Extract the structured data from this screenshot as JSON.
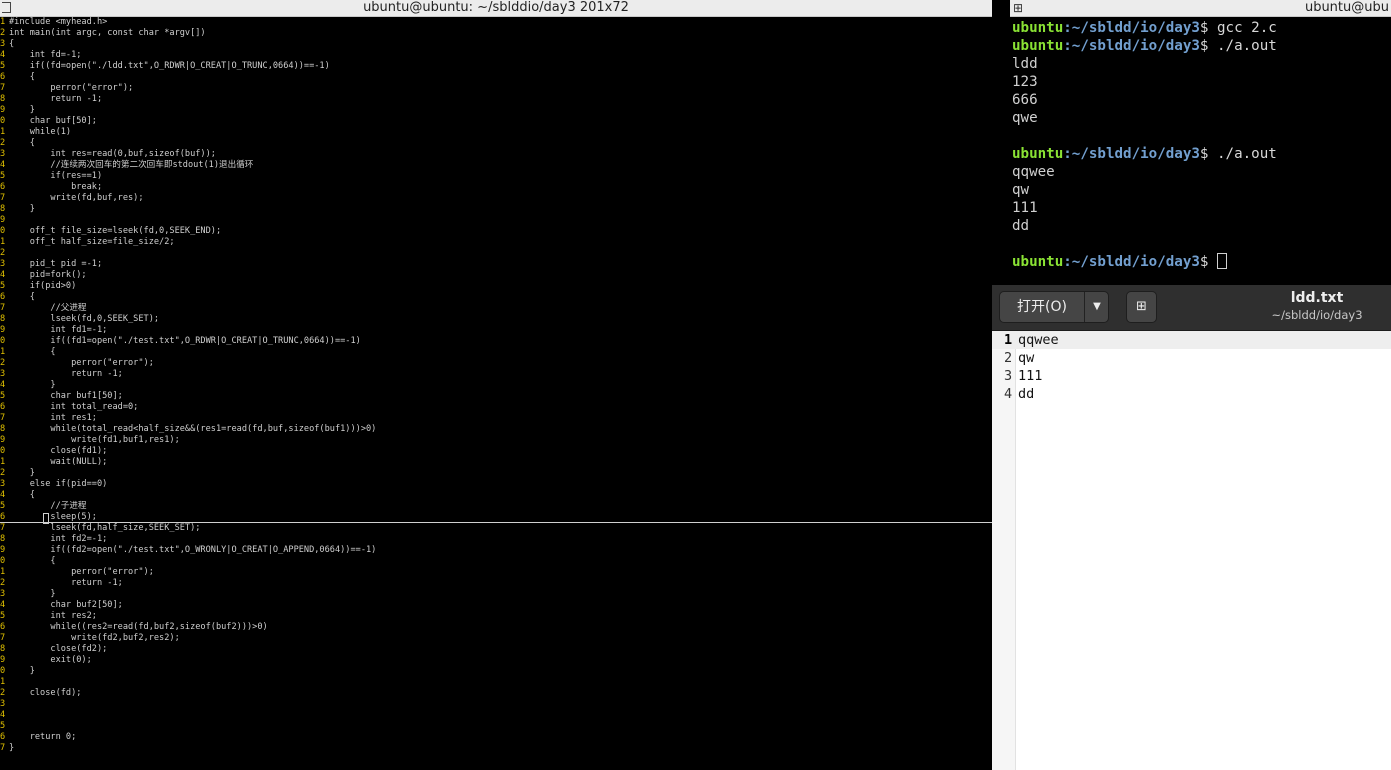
{
  "left_terminal": {
    "title": "ubuntu@ubuntu: ~/sblddio/day3 201x72",
    "code_lines": [
      {
        "n": "1",
        "text": "#include <myhead.h>"
      },
      {
        "n": "2",
        "text": "int main(int argc, const char *argv[])"
      },
      {
        "n": "3",
        "text": "{"
      },
      {
        "n": "4",
        "text": "    int fd=-1;"
      },
      {
        "n": "5",
        "text": "    if((fd=open(\"./ldd.txt\",O_RDWR|O_CREAT|O_TRUNC,0664))==-1)"
      },
      {
        "n": "6",
        "text": "    {"
      },
      {
        "n": "7",
        "text": "        perror(\"error\");"
      },
      {
        "n": "8",
        "text": "        return -1;"
      },
      {
        "n": "9",
        "text": "    }"
      },
      {
        "n": "0",
        "text": "    char buf[50];"
      },
      {
        "n": "1",
        "text": "    while(1)"
      },
      {
        "n": "2",
        "text": "    {"
      },
      {
        "n": "3",
        "text": "        int res=read(0,buf,sizeof(buf));"
      },
      {
        "n": "4",
        "text": "        //连续两次回车的第二次回车即stdout(1)退出循环"
      },
      {
        "n": "5",
        "text": "        if(res==1)"
      },
      {
        "n": "6",
        "text": "            break;"
      },
      {
        "n": "7",
        "text": "        write(fd,buf,res);"
      },
      {
        "n": "8",
        "text": "    }"
      },
      {
        "n": "9",
        "text": ""
      },
      {
        "n": "0",
        "text": "    off_t file_size=lseek(fd,0,SEEK_END);"
      },
      {
        "n": "1",
        "text": "    off_t half_size=file_size/2;"
      },
      {
        "n": "2",
        "text": ""
      },
      {
        "n": "3",
        "text": "    pid_t pid =-1;"
      },
      {
        "n": "4",
        "text": "    pid=fork();"
      },
      {
        "n": "5",
        "text": "    if(pid>0)"
      },
      {
        "n": "6",
        "text": "    {"
      },
      {
        "n": "7",
        "text": "        //父进程"
      },
      {
        "n": "8",
        "text": "        lseek(fd,0,SEEK_SET);"
      },
      {
        "n": "9",
        "text": "        int fd1=-1;"
      },
      {
        "n": "0",
        "text": "        if((fd1=open(\"./test.txt\",O_RDWR|O_CREAT|O_TRUNC,0664))==-1)"
      },
      {
        "n": "1",
        "text": "        {"
      },
      {
        "n": "2",
        "text": "            perror(\"error\");"
      },
      {
        "n": "3",
        "text": "            return -1;"
      },
      {
        "n": "4",
        "text": "        }"
      },
      {
        "n": "5",
        "text": "        char buf1[50];"
      },
      {
        "n": "6",
        "text": "        int total_read=0;"
      },
      {
        "n": "7",
        "text": "        int res1;"
      },
      {
        "n": "8",
        "text": "        while(total_read<half_size&&(res1=read(fd,buf,sizeof(buf1)))>0)"
      },
      {
        "n": "9",
        "text": "            write(fd1,buf1,res1);"
      },
      {
        "n": "0",
        "text": "        close(fd1);"
      },
      {
        "n": "1",
        "text": "        wait(NULL);"
      },
      {
        "n": "2",
        "text": "    }"
      },
      {
        "n": "3",
        "text": "    else if(pid==0)"
      },
      {
        "n": "4",
        "text": "    {"
      },
      {
        "n": "5",
        "text": "        //子进程"
      },
      {
        "n": "6",
        "text": "        sleep(5);"
      },
      {
        "n": "7",
        "text": "        lseek(fd,half_size,SEEK_SET);"
      },
      {
        "n": "8",
        "text": "        int fd2=-1;"
      },
      {
        "n": "9",
        "text": "        if((fd2=open(\"./test.txt\",O_WRONLY|O_CREAT|O_APPEND,0664))==-1)"
      },
      {
        "n": "0",
        "text": "        {"
      },
      {
        "n": "1",
        "text": "            perror(\"error\");"
      },
      {
        "n": "2",
        "text": "            return -1;"
      },
      {
        "n": "3",
        "text": "        }"
      },
      {
        "n": "4",
        "text": "        char buf2[50];"
      },
      {
        "n": "5",
        "text": "        int res2;"
      },
      {
        "n": "6",
        "text": "        while((res2=read(fd,buf2,sizeof(buf2)))>0)"
      },
      {
        "n": "7",
        "text": "            write(fd2,buf2,res2);"
      },
      {
        "n": "8",
        "text": "        close(fd2);"
      },
      {
        "n": "9",
        "text": "        exit(0);"
      },
      {
        "n": "0",
        "text": "    }"
      },
      {
        "n": "1",
        "text": ""
      },
      {
        "n": "2",
        "text": "    close(fd);"
      },
      {
        "n": "3",
        "text": ""
      },
      {
        "n": "4",
        "text": ""
      },
      {
        "n": "5",
        "text": ""
      },
      {
        "n": "6",
        "text": "    return 0;"
      },
      {
        "n": "7",
        "text": "}"
      }
    ]
  },
  "right_terminal": {
    "title": "ubuntu@ubu",
    "lines": [
      {
        "type": "prompt",
        "user": "ubuntu",
        "path": ":~/sbldd/io/day3",
        "cmd": "$ gcc 2.c"
      },
      {
        "type": "prompt",
        "user": "ubuntu",
        "path": ":~/sbldd/io/day3",
        "cmd": "$ ./a.out"
      },
      {
        "type": "out",
        "text": "ldd"
      },
      {
        "type": "out",
        "text": "123"
      },
      {
        "type": "out",
        "text": "666"
      },
      {
        "type": "out",
        "text": "qwe"
      },
      {
        "type": "out",
        "text": ""
      },
      {
        "type": "prompt",
        "user": "ubuntu",
        "path": ":~/sbldd/io/day3",
        "cmd": "$ ./a.out"
      },
      {
        "type": "out",
        "text": "qqwee"
      },
      {
        "type": "out",
        "text": "qw"
      },
      {
        "type": "out",
        "text": "111"
      },
      {
        "type": "out",
        "text": "dd"
      },
      {
        "type": "out",
        "text": ""
      },
      {
        "type": "prompt_cursor",
        "user": "ubuntu",
        "path": ":~/sbldd/io/day3",
        "cmd": "$ "
      }
    ]
  },
  "gedit": {
    "open_label": "打开(O)",
    "open_menu_icon": "chevron-down-icon",
    "new_tab_icon": "new-tab-icon",
    "doc_name": "ldd.txt",
    "doc_path": "~/sbldd/io/day3",
    "lines": [
      {
        "n": "1",
        "text": "qqwee",
        "current": true
      },
      {
        "n": "2",
        "text": "qw",
        "current": false
      },
      {
        "n": "3",
        "text": "111",
        "current": false
      },
      {
        "n": "4",
        "text": "dd",
        "current": false
      }
    ]
  },
  "colors": {
    "terminal_bg": "#000000",
    "prompt_user": "#8ae234",
    "prompt_path": "#729fcf",
    "line_number": "#e0c000",
    "header_bg": "#2f2f2f"
  }
}
